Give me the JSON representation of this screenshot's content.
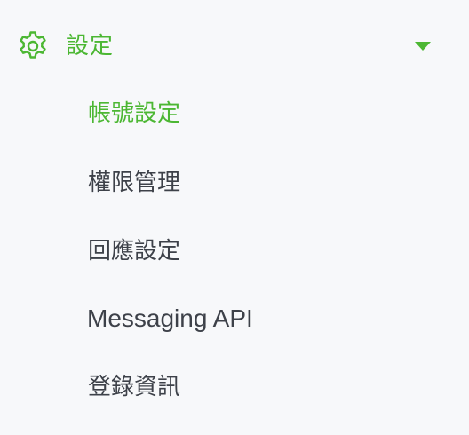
{
  "colors": {
    "accent": "#4cb733",
    "text": "#3d4149",
    "background": "#f7f8fa"
  },
  "menu": {
    "header": {
      "icon": "gear-icon",
      "label": "設定",
      "expanded_icon": "caret-down-icon"
    },
    "items": [
      {
        "label": "帳號設定",
        "active": true
      },
      {
        "label": "權限管理",
        "active": false
      },
      {
        "label": "回應設定",
        "active": false
      },
      {
        "label": "Messaging API",
        "active": false
      },
      {
        "label": "登錄資訊",
        "active": false
      }
    ]
  }
}
